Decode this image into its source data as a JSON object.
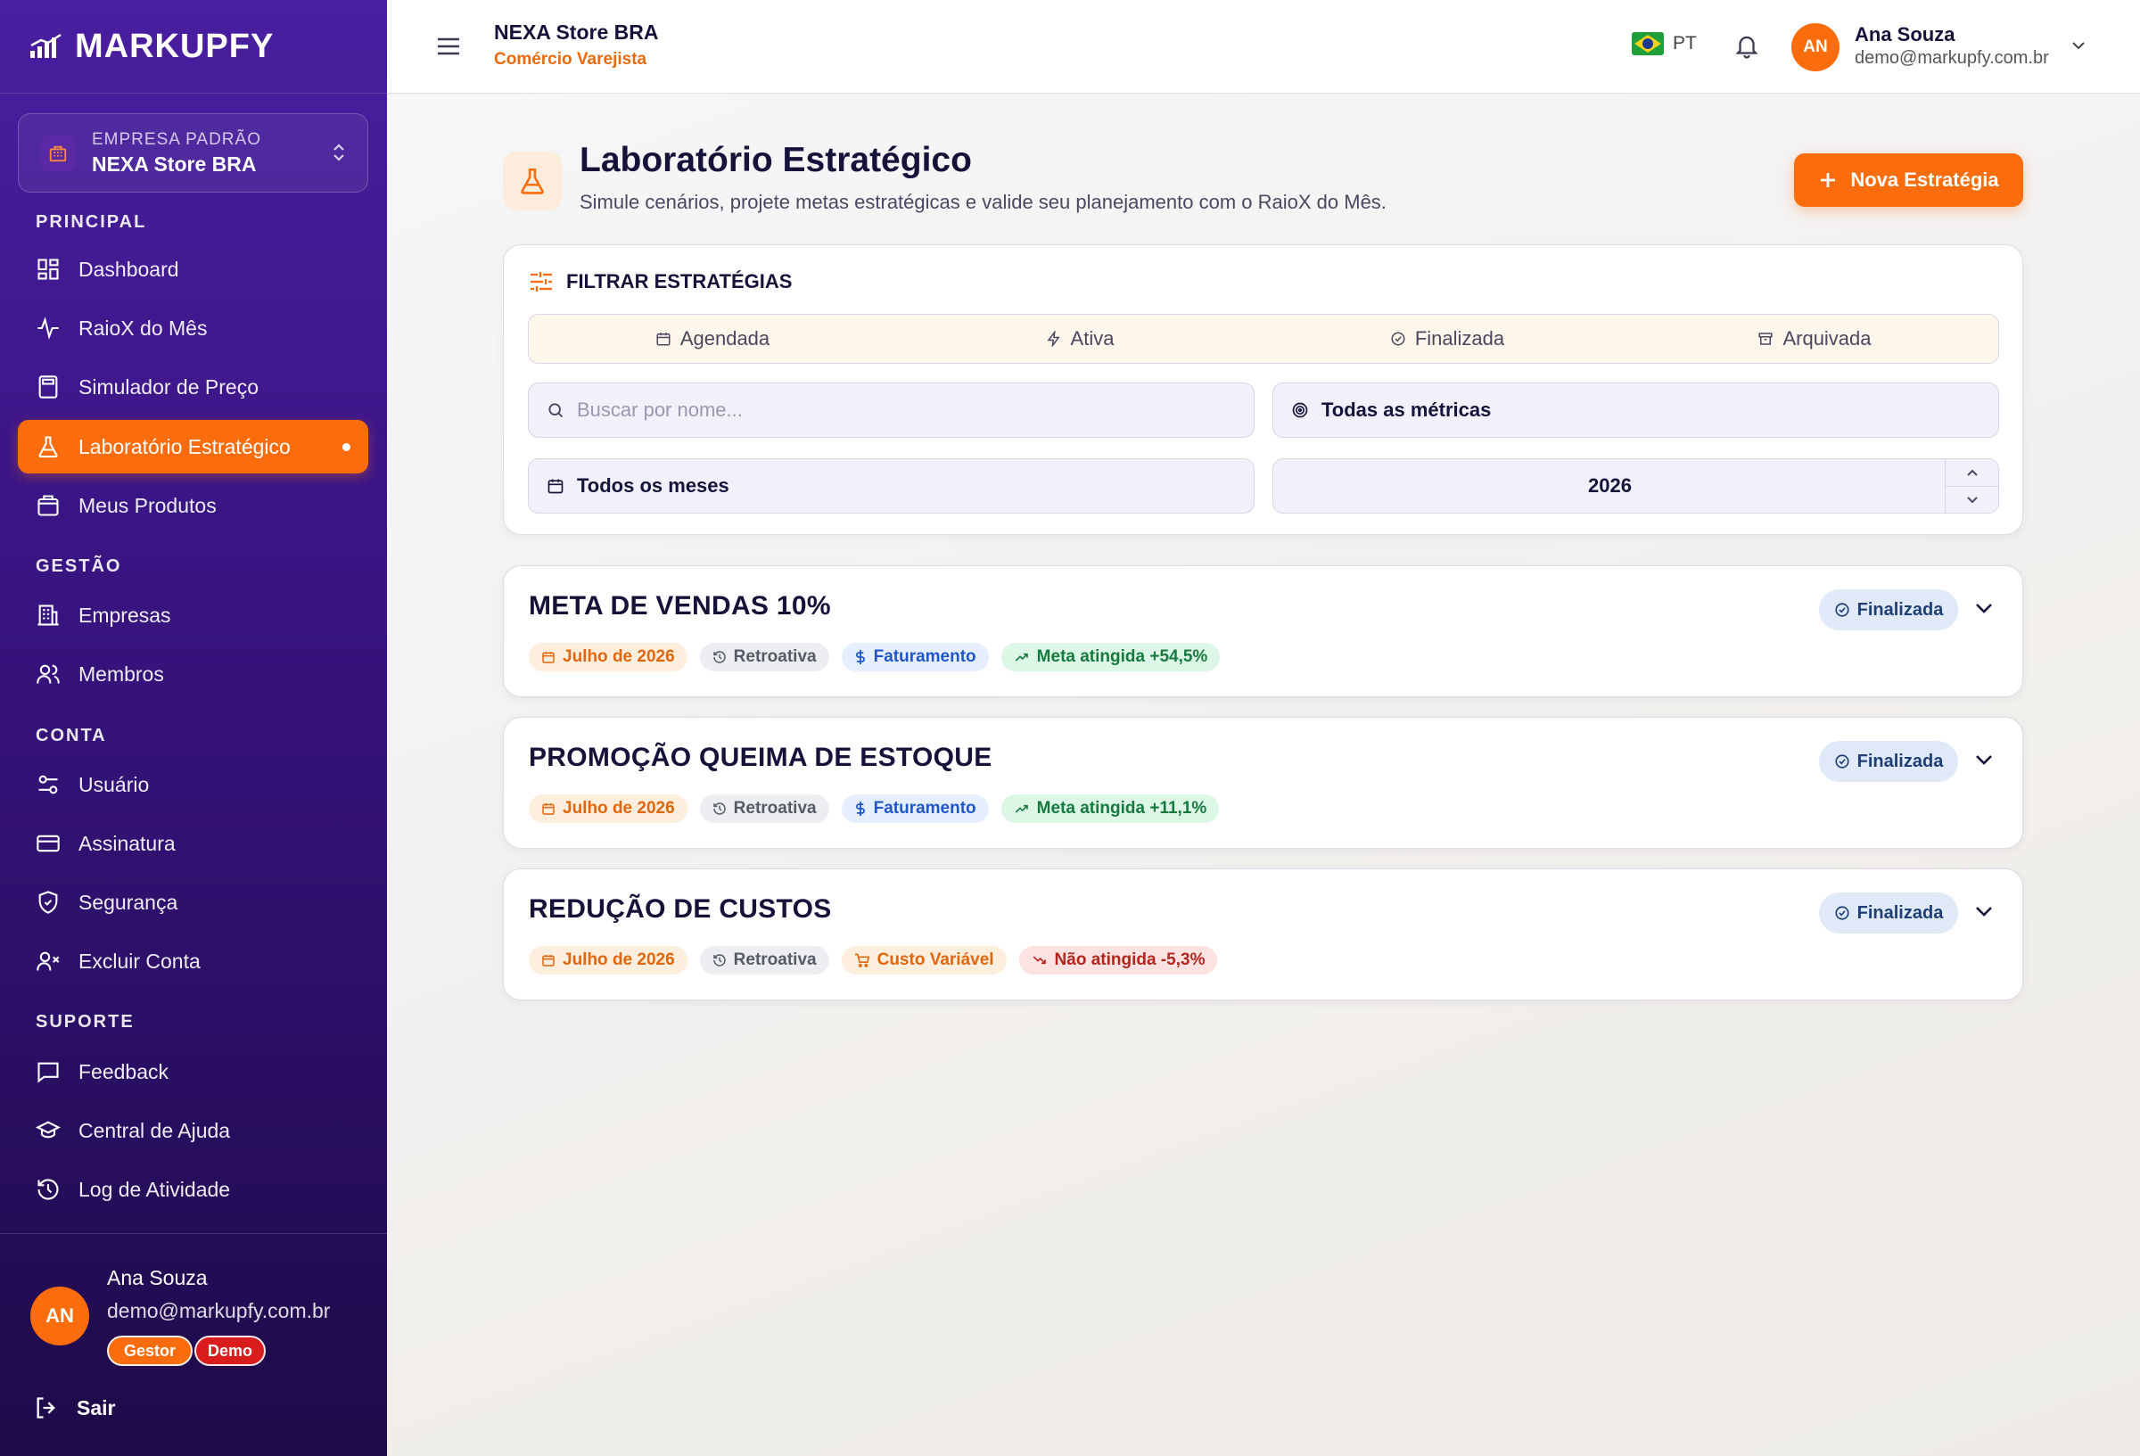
{
  "brand": {
    "name": "MARKUPFY"
  },
  "company": {
    "label": "EMPRESA PADRÃO",
    "name": "NEXA Store BRA"
  },
  "sections": {
    "principal": "PRINCIPAL",
    "gestao": "GESTÃO",
    "conta": "CONTA",
    "suporte": "SUPORTE"
  },
  "nav": {
    "dashboard": "Dashboard",
    "raiox": "RaioX do Mês",
    "simulador": "Simulador de Preço",
    "laboratorio": "Laboratório Estratégico",
    "produtos": "Meus Produtos",
    "empresas": "Empresas",
    "membros": "Membros",
    "usuario": "Usuário",
    "assinatura": "Assinatura",
    "seguranca": "Segurança",
    "excluir": "Excluir Conta",
    "feedback": "Feedback",
    "ajuda": "Central de Ajuda",
    "log": "Log de Atividade"
  },
  "sidebar_user": {
    "initials": "AN",
    "name": "Ana Souza",
    "email": "demo@markupfy.com.br",
    "role_badge": "Gestor",
    "demo_badge": "Demo",
    "logout": "Sair"
  },
  "header": {
    "store_name": "NEXA Store BRA",
    "store_segment": "Comércio Varejista",
    "language": "PT",
    "user_initials": "AN",
    "user_name": "Ana Souza",
    "user_email": "demo@markupfy.com.br"
  },
  "page": {
    "title": "Laboratório Estratégico",
    "subtitle": "Simule cenários, projete metas estratégicas e valide seu planejamento com o RaioX do Mês.",
    "new_button": "Nova Estratégia"
  },
  "filters": {
    "title": "FILTRAR ESTRATÉGIAS",
    "status_tabs": [
      "Agendada",
      "Ativa",
      "Finalizada",
      "Arquivada"
    ],
    "search_placeholder": "Buscar por nome...",
    "metric_value": "Todas as métricas",
    "month_value": "Todos os meses",
    "year_value": "2026"
  },
  "strategies": [
    {
      "title": "META DE VENDAS 10%",
      "date": "Julho de 2026",
      "type": "Retroativa",
      "metric": "Faturamento",
      "result": "Meta atingida +54,5%",
      "status": "Finalizada"
    },
    {
      "title": "PROMOÇÃO QUEIMA DE ESTOQUE",
      "date": "Julho de 2026",
      "type": "Retroativa",
      "metric": "Faturamento",
      "result": "Meta atingida +11,1%",
      "status": "Finalizada"
    },
    {
      "title": "REDUÇÃO DE CUSTOS",
      "date": "Julho de 2026",
      "type": "Retroativa",
      "metric": "Custo Variável",
      "result": "Não atingida -5,3%",
      "status": "Finalizada"
    }
  ],
  "colors": {
    "accent": "#fb6d0c",
    "sidebar_top": "#4a1fa0",
    "sidebar_bottom": "#1e0a48",
    "success": "#167a3e",
    "danger": "#b3261e",
    "demo_badge": "#d91c1c"
  }
}
